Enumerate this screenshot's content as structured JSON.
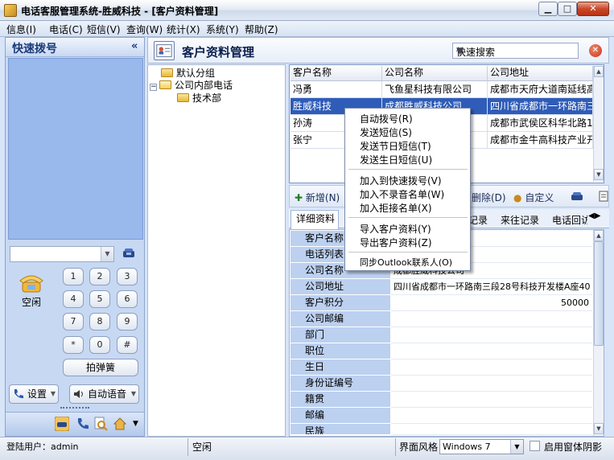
{
  "window": {
    "title": "电话客服管理系统-胜威科技 - [客户资料管理]",
    "min_label": "▁",
    "max_label": "□",
    "close_label": "✕"
  },
  "menu": [
    "信息(I)",
    "电话(C)",
    "短信(V)",
    "查询(W)",
    "统计(X)",
    "系统(Y)",
    "帮助(Z)"
  ],
  "sidebar": {
    "title": "快速拨号",
    "collapse": "«",
    "status": "空闲",
    "keys": [
      "1",
      "2",
      "3",
      "4",
      "5",
      "6",
      "7",
      "8",
      "9",
      "*",
      "0",
      "#"
    ],
    "redial": "拍弹簧",
    "settings": "设置",
    "auto_voice": "自动语音"
  },
  "header": {
    "title": "客户资料管理",
    "search_label": "快速搜索",
    "clear": "✕"
  },
  "tree": {
    "default_group": "默认分组",
    "internal": "公司内部电话",
    "dept": "技术部",
    "expander": "−"
  },
  "grid": {
    "columns": [
      "客户名称",
      "公司名称",
      "公司地址"
    ],
    "rows": [
      [
        "冯勇",
        "飞鱼星科技有限公司",
        "成都市天府大道南延线高"
      ],
      [
        "胜威科技",
        "成都胜威科技公司",
        "四川省成都市一环路南三"
      ],
      [
        "孙涛",
        "",
        "成都市武侯区科华北路1"
      ],
      [
        "张宁",
        "…公",
        "成都市金牛高科技产业开"
      ]
    ]
  },
  "toolbar": {
    "add": "新增(N)",
    "delete": "删除(D)",
    "custom": "自定义"
  },
  "tabs": [
    "详细资料",
    "记录",
    "来往记录",
    "电话回访"
  ],
  "detail": [
    {
      "label": "客户名称",
      "value": ""
    },
    {
      "label": "电话列表",
      "value": ""
    },
    {
      "label": "公司名称",
      "value": "成都胜威科技公司"
    },
    {
      "label": "公司地址",
      "value": "四川省成都市一环路南三段28号科技开发楼A座40"
    },
    {
      "label": "客户积分",
      "value": "50000"
    },
    {
      "label": "公司邮编",
      "value": ""
    },
    {
      "label": "部门",
      "value": ""
    },
    {
      "label": "职位",
      "value": ""
    },
    {
      "label": "生日",
      "value": ""
    },
    {
      "label": "身份证编号",
      "value": ""
    },
    {
      "label": "籍贯",
      "value": ""
    },
    {
      "label": "邮编",
      "value": ""
    },
    {
      "label": "民族",
      "value": ""
    }
  ],
  "context_menu": {
    "group1": [
      "自动拨号(R)",
      "发送短信(S)",
      "发送节日短信(T)",
      "发送生日短信(U)"
    ],
    "group2": [
      "加入到快速拨号(V)",
      "加入不录音名单(W)",
      "加入拒接名单(X)"
    ],
    "group3": [
      "导入客户资料(Y)",
      "导出客户资料(Z)"
    ],
    "group4": [
      "同步Outlook联系人(O)"
    ]
  },
  "status": {
    "user": "登陆用户：admin",
    "state": "空闲",
    "theme_label": "界面风格",
    "theme_value": "Windows 7",
    "shadow_label": "启用窗体阴影"
  }
}
